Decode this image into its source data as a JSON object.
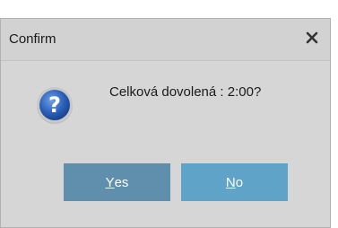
{
  "dialog": {
    "title": "Confirm",
    "message": "Celková dovolená : 2:00?",
    "icon": "question-icon"
  },
  "buttons": {
    "yes": {
      "mnemonic": "Y",
      "rest": "es"
    },
    "no": {
      "mnemonic": "N",
      "rest": "o"
    }
  },
  "colors": {
    "yes_button": "#5f8fad",
    "no_button": "#5fa3c8",
    "dialog_bg": "#d6d6d6"
  }
}
